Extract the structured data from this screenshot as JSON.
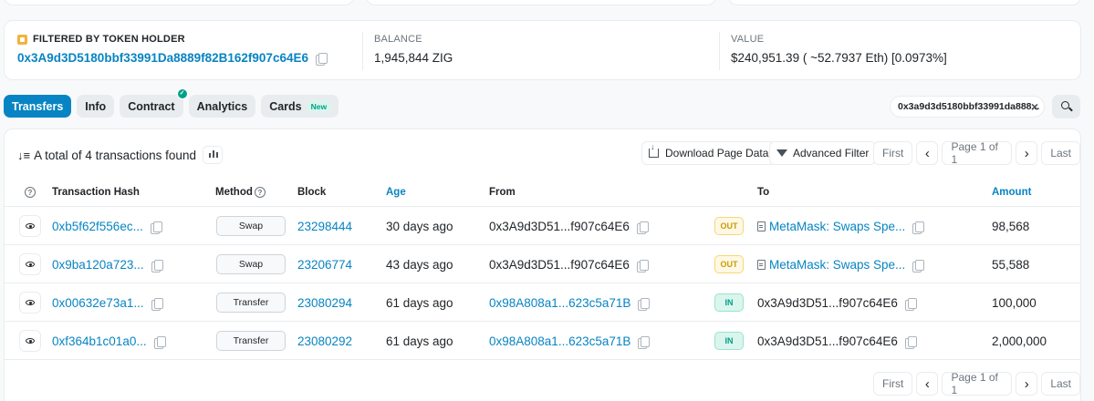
{
  "holder": {
    "filter_label": "FILTERED BY TOKEN HOLDER",
    "address": "0x3A9d3D5180bbf33991Da8889f82B162f907c64E6",
    "balance_label": "BALANCE",
    "balance_value": "1,945,844 ZIG",
    "value_label": "VALUE",
    "value_value": "$240,951.39 ( ~52.7937 Eth) [0.0973%]"
  },
  "tabs": [
    {
      "label": "Transfers",
      "active": true
    },
    {
      "label": "Info"
    },
    {
      "label": "Contract"
    },
    {
      "label": "Analytics"
    },
    {
      "label": "Cards",
      "badge": "New"
    }
  ],
  "filter_chip": {
    "text": "0x3a9d3d5180bbf33991da888...",
    "close": "×"
  },
  "summary": {
    "sort_icon": "↓≡",
    "text": "A total of 4 transactions found"
  },
  "toolbar": {
    "download": "Download Page Data",
    "advanced": "Advanced Filter"
  },
  "pager": {
    "first": "First",
    "prev": "‹",
    "page": "Page 1 of 1",
    "next": "›",
    "last": "Last"
  },
  "table": {
    "help": "?",
    "headers": {
      "hash": "Transaction Hash",
      "method": "Method",
      "block": "Block",
      "age": "Age",
      "from": "From",
      "to": "To",
      "amount": "Amount"
    },
    "rows": [
      {
        "hash": "0xb5f62f556ec...",
        "method": "Swap",
        "block": "23298444",
        "age": "30 days ago",
        "from": "0x3A9d3D51...f907c64E6",
        "dir": "OUT",
        "to": "MetaMask: Swaps Spe...",
        "amount": "98,568"
      },
      {
        "hash": "0x9ba120a723...",
        "method": "Swap",
        "block": "23206774",
        "age": "43 days ago",
        "from": "0x3A9d3D51...f907c64E6",
        "dir": "OUT",
        "to": "MetaMask: Swaps Spe...",
        "amount": "55,588"
      },
      {
        "hash": "0x00632e73a1...",
        "method": "Transfer",
        "block": "23080294",
        "age": "61 days ago",
        "from": "0x98A808a1...623c5a71B",
        "dir": "IN",
        "to": "0x3A9d3D51...f907c64E6",
        "amount": "100,000"
      },
      {
        "hash": "0xf364b1c01a0...",
        "method": "Transfer",
        "block": "23080292",
        "age": "61 days ago",
        "from": "0x98A808a1...623c5a71B",
        "dir": "IN",
        "to": "0x3A9d3D51...f907c64E6",
        "amount": "2,000,000"
      }
    ]
  }
}
